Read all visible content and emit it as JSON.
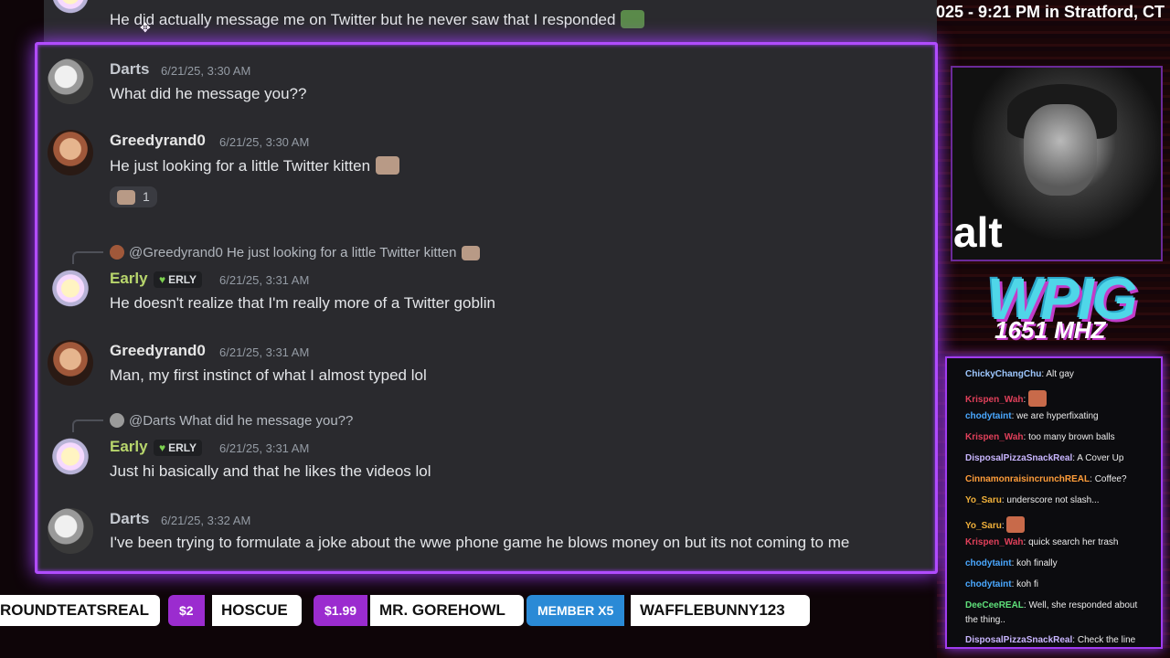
{
  "clock": "025 - 9:21 PM in Stratford, CT",
  "overlay": {
    "alt_label": "alt",
    "station_logo": "WPIG",
    "station_freq": "1651 MHZ"
  },
  "colors": {
    "accent_purple": "#b14cff",
    "early_name": "#b8d66c",
    "greedy_name": "#e6e6e6",
    "darts_name": "#c5c9d0"
  },
  "messages": {
    "top_cut": {
      "text": "He did actually message me on Twitter but he never saw that I responded"
    },
    "m1": {
      "author": "Darts",
      "timestamp": "6/21/25, 3:30 AM",
      "text": "What did he message you??"
    },
    "m2": {
      "author": "Greedyrand0",
      "timestamp": "6/21/25, 3:30 AM",
      "text": "He just looking for a little Twitter kitten",
      "reaction_count": "1"
    },
    "m3": {
      "reply_to": "@Greedyrand0",
      "reply_text": "He just looking for a little Twitter kitten",
      "author": "Early",
      "badge": "ERLY",
      "timestamp": "6/21/25, 3:31 AM",
      "text": "He doesn't realize that I'm really more of a Twitter goblin"
    },
    "m4": {
      "author": "Greedyrand0",
      "timestamp": "6/21/25, 3:31 AM",
      "text": "Man, my first instinct of what I almost typed lol"
    },
    "m5": {
      "reply_to": "@Darts",
      "reply_text": "What did he message you??",
      "author": "Early",
      "badge": "ERLY",
      "timestamp": "6/21/25, 3:31 AM",
      "text": "Just hi basically and that he likes the videos lol"
    },
    "m6": {
      "author": "Darts",
      "timestamp": "6/21/25, 3:32 AM",
      "text": "I've been trying to formulate a joke about the wwe phone game he blows money on but its not coming to me"
    }
  },
  "chat": [
    {
      "user": "ChickyChangChu",
      "color": "#9ec8ff",
      "text": "Alt gay"
    },
    {
      "user": "Krispen_Wah",
      "color": "#e0405a",
      "text": "",
      "emote": true
    },
    {
      "user": "chodytaint",
      "color": "#4aa8ff",
      "text": "we are hyperfixating"
    },
    {
      "user": "Krispen_Wah",
      "color": "#e0405a",
      "text": "too many brown balls"
    },
    {
      "user": "DisposalPizzaSnackReal",
      "color": "#c9b6ff",
      "text": "A Cover Up"
    },
    {
      "user": "CinnamonraisincrunchREAL",
      "color": "#ff9d3a",
      "text": "Coffee?"
    },
    {
      "user": "Yo_Saru",
      "color": "#f0b03a",
      "text": "underscore not slash..."
    },
    {
      "user": "Yo_Saru",
      "color": "#f0b03a",
      "text": "",
      "emote": true
    },
    {
      "user": "Krispen_Wah",
      "color": "#e0405a",
      "text": "quick search her trash"
    },
    {
      "user": "chodytaint",
      "color": "#4aa8ff",
      "text": "koh finally"
    },
    {
      "user": "chodytaint",
      "color": "#4aa8ff",
      "text": "koh fi"
    },
    {
      "user": "DeeCeeREAL",
      "color": "#5fe07a",
      "text": "Well, she responded about"
    },
    {
      "user": "",
      "color": "#ececec",
      "text": "the thing.."
    },
    {
      "user": "DisposalPizzaSnackReal",
      "color": "#c9b6ff",
      "text": "Check the line"
    }
  ],
  "ticker": {
    "item0": {
      "name": "ROUNDTEATSREAL"
    },
    "item1": {
      "tag": "$2",
      "name": "HOSCUE"
    },
    "item2": {
      "tag": "$1.99",
      "name": "MR. GOREHOWL"
    },
    "item3": {
      "tag": "MEMBER X5",
      "name": "WAFFLEBUNNY123"
    }
  }
}
